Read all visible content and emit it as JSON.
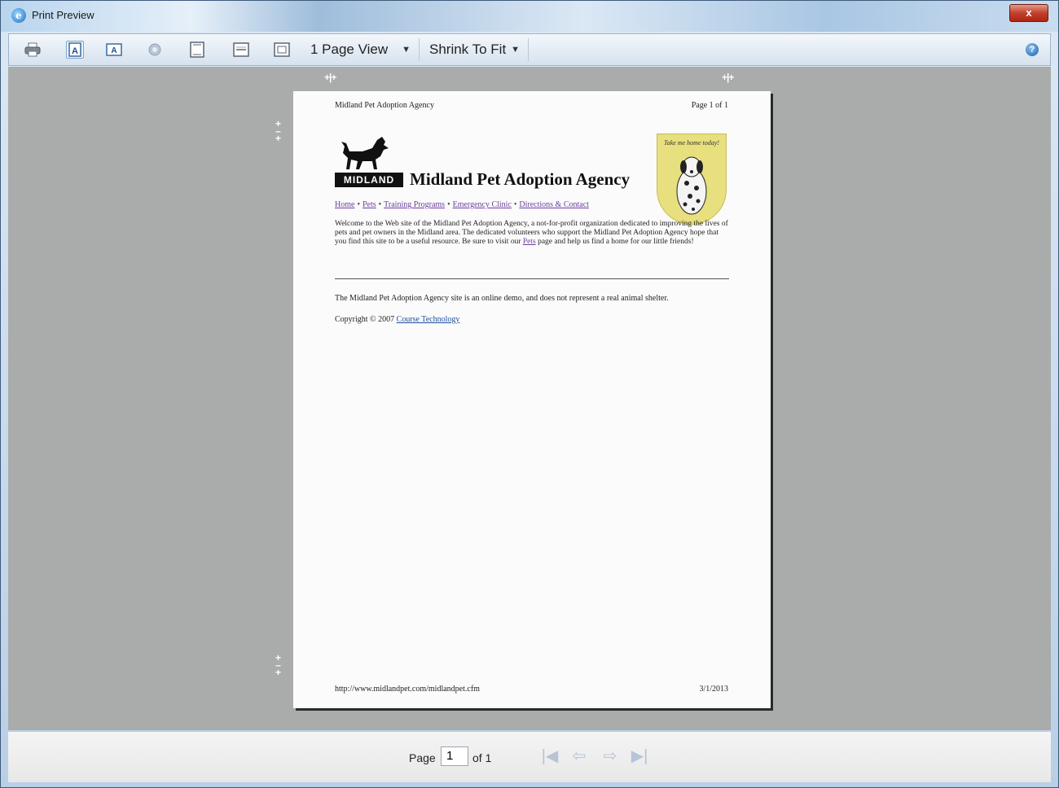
{
  "window": {
    "title": "Print Preview",
    "close_label": "x"
  },
  "toolbar": {
    "view_select": "1 Page View",
    "fit_select": "Shrink To Fit",
    "icons": [
      "print-icon",
      "portrait-icon",
      "landscape-icon",
      "page-setup-icon",
      "header-footer-icon",
      "full-width-icon",
      "full-page-icon",
      "help-icon"
    ]
  },
  "document": {
    "header_left": "Midland Pet Adoption Agency",
    "header_right": "Page 1 of 1",
    "logo_text": "MIDLAND",
    "site_title": "Midland Pet Adoption Agency",
    "badge_text": "Take me home today!",
    "nav": [
      "Home",
      "Pets",
      "Training Programs",
      "Emergency Clinic",
      "Directions & Contact"
    ],
    "intro_a": "Welcome to the Web site of the Midland Pet Adoption Agency, a not-for-profit organization dedicated to improving the lives of pets and pet owners in the Midland area. The dedicated volunteers who support the Midland Pet Adoption Agency hope that you find this site to be a useful resource. Be sure to visit our ",
    "intro_link": "Pets",
    "intro_b": " page and help us find a home for our little friends!",
    "disclaimer": "The Midland Pet Adoption Agency site is an online demo, and does not represent a real animal shelter.",
    "copyright_prefix": "Copyright © 2007 ",
    "copyright_link": "Course Technology",
    "footer_left": "http://www.midlandpet.com/midlandpet.cfm",
    "footer_right": "3/1/2013"
  },
  "statusbar": {
    "page_label": "Page",
    "page_value": "1",
    "of_label": "of 1"
  }
}
